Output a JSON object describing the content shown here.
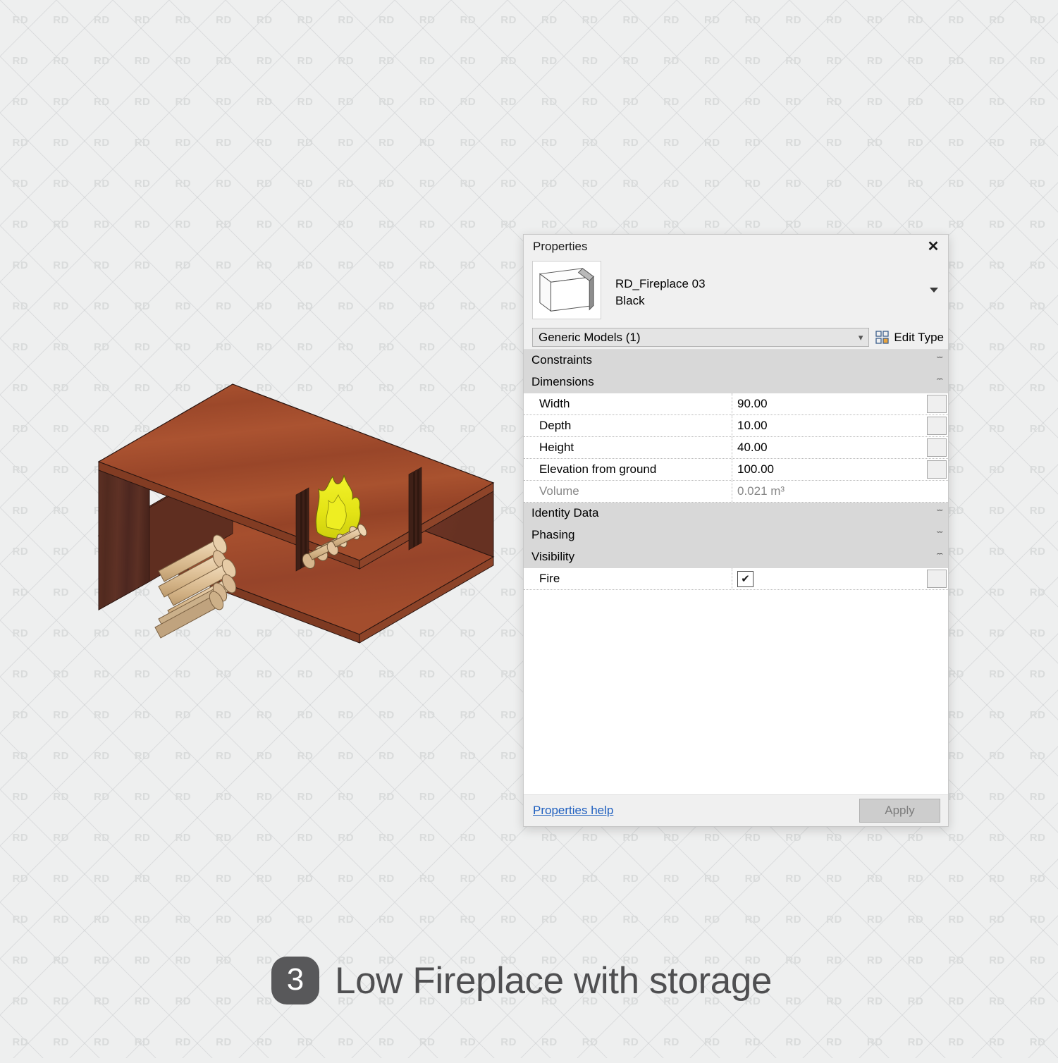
{
  "watermark": {
    "text": "RD"
  },
  "caption": {
    "number": "3",
    "title": "Low Fireplace with storage"
  },
  "palette": {
    "title": "Properties",
    "close_icon": "close-icon",
    "type_name": "RD_Fireplace 03",
    "type_variant": "Black",
    "category_selector": "Generic Models (1)",
    "edit_type_label": "Edit Type",
    "sections": [
      {
        "name": "Constraints",
        "state": "collapsed",
        "chevron": "ˇˇ"
      },
      {
        "name": "Dimensions",
        "state": "expanded",
        "chevron": "ˆˆ"
      },
      {
        "name": "Identity Data",
        "state": "collapsed",
        "chevron": "ˇˇ"
      },
      {
        "name": "Phasing",
        "state": "collapsed",
        "chevron": "ˇˇ"
      },
      {
        "name": "Visibility",
        "state": "expanded",
        "chevron": "ˆˆ"
      }
    ],
    "dimension_rows": [
      {
        "label": "Width",
        "value": "90.00",
        "readonly": false
      },
      {
        "label": "Depth",
        "value": "10.00",
        "readonly": false
      },
      {
        "label": "Height",
        "value": "40.00",
        "readonly": false
      },
      {
        "label": "Elevation from ground",
        "value": "100.00",
        "readonly": false
      },
      {
        "label": "Volume",
        "value": "0.021 m³",
        "readonly": true
      }
    ],
    "visibility_rows": [
      {
        "label": "Fire",
        "checked": true,
        "check_glyph": "✔"
      }
    ],
    "footer": {
      "help_link": "Properties help",
      "apply_label": "Apply"
    }
  },
  "render": {
    "alt": "isometric wood fireplace unit with log storage and flame",
    "colors": {
      "wood_top": "#a8502f",
      "wood_top_dark": "#8d3f25",
      "wood_side": "#5a2e22",
      "wood_side_dark": "#48241a",
      "wood_inner": "#6d3524",
      "log_light": "#e8cfab",
      "log_mid": "#d9b88c",
      "log_dark": "#c49d72",
      "flame": "#e8e81a",
      "flame_dark": "#cfcf10",
      "outline": "#2a1510"
    }
  }
}
